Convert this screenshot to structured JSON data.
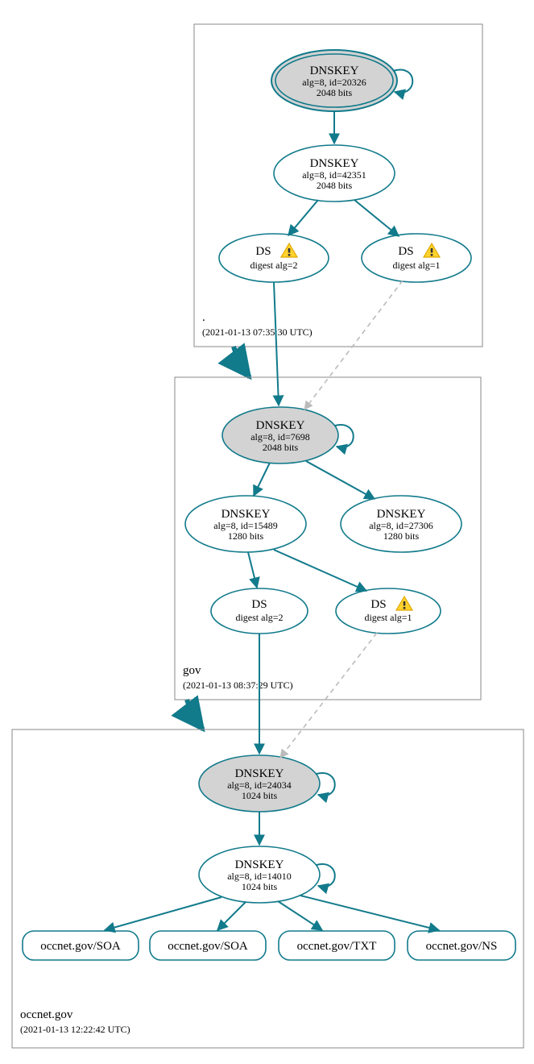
{
  "chart_data": {
    "type": "table",
    "title": "DNSSEC chain of trust diagram",
    "zones": [
      {
        "name": ".",
        "timestamp": "2021-01-13 07:35:30 UTC"
      },
      {
        "name": "gov",
        "timestamp": "2021-01-13 08:37:29 UTC"
      },
      {
        "name": "occnet.gov",
        "timestamp": "2021-01-13 12:22:42 UTC"
      }
    ],
    "nodes": [
      {
        "id": "rootKSK",
        "zone": ".",
        "type": "DNSKEY",
        "alg": 8,
        "keyid": 20326,
        "bits": 2048,
        "trust_anchor": true,
        "self_signed": true
      },
      {
        "id": "rootZSK",
        "zone": ".",
        "type": "DNSKEY",
        "alg": 8,
        "keyid": 42351,
        "bits": 2048
      },
      {
        "id": "rootDS2",
        "zone": ".",
        "type": "DS",
        "digest_alg": 2,
        "warning": true
      },
      {
        "id": "rootDS1",
        "zone": ".",
        "type": "DS",
        "digest_alg": 1,
        "warning": true
      },
      {
        "id": "govKSK",
        "zone": "gov",
        "type": "DNSKEY",
        "alg": 8,
        "keyid": 7698,
        "bits": 2048,
        "self_signed": true
      },
      {
        "id": "govZSK1",
        "zone": "gov",
        "type": "DNSKEY",
        "alg": 8,
        "keyid": 15489,
        "bits": 1280
      },
      {
        "id": "govZSK2",
        "zone": "gov",
        "type": "DNSKEY",
        "alg": 8,
        "keyid": 27306,
        "bits": 1280
      },
      {
        "id": "govDS2",
        "zone": "gov",
        "type": "DS",
        "digest_alg": 2
      },
      {
        "id": "govDS1",
        "zone": "gov",
        "type": "DS",
        "digest_alg": 1,
        "warning": true
      },
      {
        "id": "occKSK",
        "zone": "occnet.gov",
        "type": "DNSKEY",
        "alg": 8,
        "keyid": 24034,
        "bits": 1024,
        "self_signed": true
      },
      {
        "id": "occZSK",
        "zone": "occnet.gov",
        "type": "DNSKEY",
        "alg": 8,
        "keyid": 14010,
        "bits": 1024,
        "self_signed": true
      }
    ],
    "rrsets": [
      "occnet.gov/SOA",
      "occnet.gov/SOA",
      "occnet.gov/TXT",
      "occnet.gov/NS"
    ],
    "edges": [
      {
        "from": "rootKSK",
        "to": "rootKSK",
        "style": "solid"
      },
      {
        "from": "rootKSK",
        "to": "rootZSK",
        "style": "solid"
      },
      {
        "from": "rootZSK",
        "to": "rootDS2",
        "style": "solid"
      },
      {
        "from": "rootZSK",
        "to": "rootDS1",
        "style": "solid"
      },
      {
        "from": "rootDS2",
        "to": "govKSK",
        "style": "solid"
      },
      {
        "from": "rootDS1",
        "to": "govKSK",
        "style": "dashed-weak"
      },
      {
        "from": "zone:.",
        "to": "zone:gov",
        "style": "zone-delegation"
      },
      {
        "from": "govKSK",
        "to": "govKSK",
        "style": "solid"
      },
      {
        "from": "govKSK",
        "to": "govZSK1",
        "style": "solid"
      },
      {
        "from": "govKSK",
        "to": "govZSK2",
        "style": "solid"
      },
      {
        "from": "govZSK1",
        "to": "govDS2",
        "style": "solid"
      },
      {
        "from": "govZSK1",
        "to": "govDS1",
        "style": "solid"
      },
      {
        "from": "govDS2",
        "to": "occKSK",
        "style": "solid"
      },
      {
        "from": "govDS1",
        "to": "occKSK",
        "style": "dashed-weak"
      },
      {
        "from": "zone:gov",
        "to": "zone:occnet.gov",
        "style": "zone-delegation"
      },
      {
        "from": "occKSK",
        "to": "occKSK",
        "style": "solid"
      },
      {
        "from": "occKSK",
        "to": "occZSK",
        "style": "solid"
      },
      {
        "from": "occZSK",
        "to": "occZSK",
        "style": "solid"
      },
      {
        "from": "occZSK",
        "to": "rr:occnet.gov/SOA",
        "style": "solid"
      },
      {
        "from": "occZSK",
        "to": "rr:occnet.gov/SOA",
        "style": "solid"
      },
      {
        "from": "occZSK",
        "to": "rr:occnet.gov/TXT",
        "style": "solid"
      },
      {
        "from": "occZSK",
        "to": "rr:occnet.gov/NS",
        "style": "solid"
      }
    ]
  },
  "labels": {
    "dnskey": "DNSKEY",
    "ds": "DS",
    "digest_alg_prefix": "digest alg=",
    "alg_id_fmt": "alg=%A, id=%I",
    "bits_suffix": " bits"
  },
  "colors": {
    "teal": "#117a8b",
    "shaded_fill": "#d3d3d3",
    "weak_edge": "#bbbbbb",
    "warn_fill": "#ffd22e",
    "warn_stroke": "#e0a800"
  },
  "_derived": {
    "rootKSK_sub1": "alg=8, id=20326",
    "rootKSK_sub2": "2048 bits",
    "rootZSK_sub1": "alg=8, id=42351",
    "rootZSK_sub2": "2048 bits",
    "rootDS2_sub": "digest alg=2",
    "rootDS1_sub": "digest alg=1",
    "govKSK_sub1": "alg=8, id=7698",
    "govKSK_sub2": "2048 bits",
    "govZSK1_sub1": "alg=8, id=15489",
    "govZSK1_sub2": "1280 bits",
    "govZSK2_sub1": "alg=8, id=27306",
    "govZSK2_sub2": "1280 bits",
    "govDS2_sub": "digest alg=2",
    "govDS1_sub": "digest alg=1",
    "occKSK_sub1": "alg=8, id=24034",
    "occKSK_sub2": "1024 bits",
    "occZSK_sub1": "alg=8, id=14010",
    "occZSK_sub2": "1024 bits",
    "zone_root_ts": "(2021-01-13 07:35:30 UTC)",
    "zone_gov_ts": "(2021-01-13 08:37:29 UTC)",
    "zone_occ_ts": "(2021-01-13 12:22:42 UTC)"
  }
}
